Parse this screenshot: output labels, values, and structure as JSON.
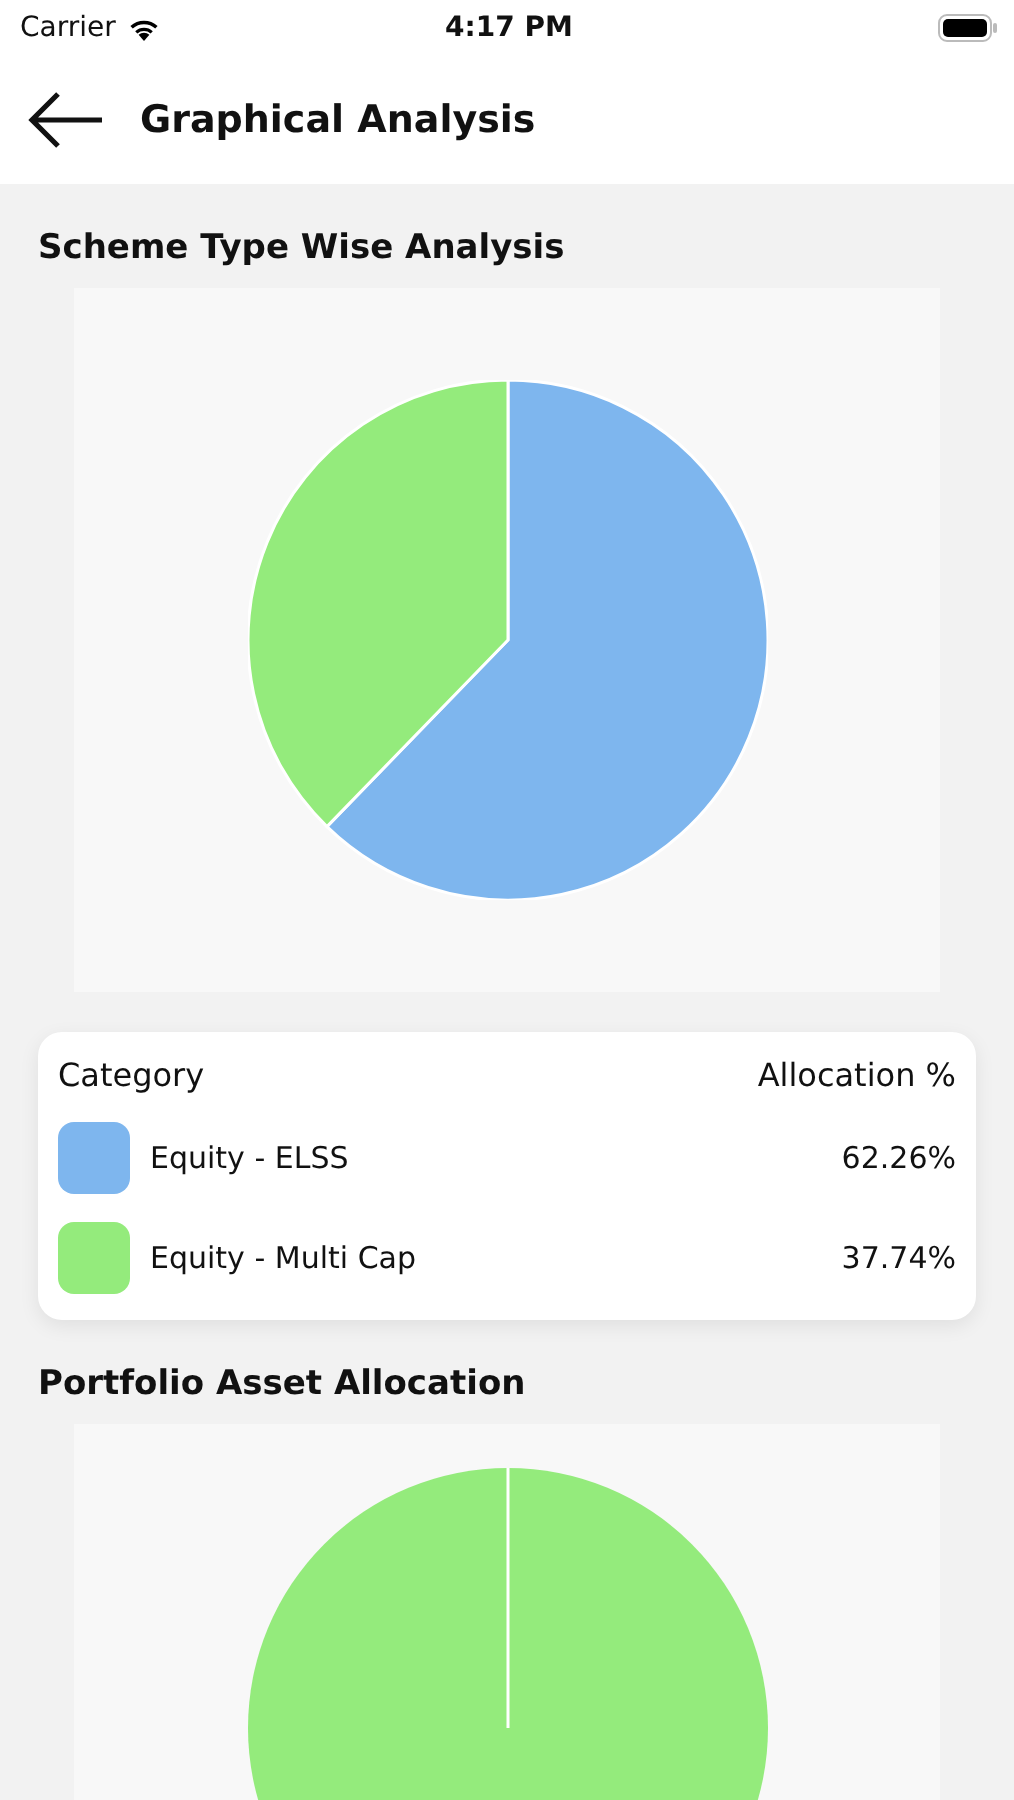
{
  "status_bar": {
    "carrier": "Carrier",
    "time": "4:17 PM"
  },
  "header": {
    "title": "Graphical Analysis"
  },
  "scheme_section": {
    "title": "Scheme Type Wise Analysis",
    "chart_data": {
      "type": "pie",
      "categories": [
        "Equity - ELSS",
        "Equity - Multi Cap"
      ],
      "series": [
        {
          "name": "Allocation %",
          "values": [
            62.26,
            37.74
          ]
        }
      ],
      "colors": [
        "#7eb6ee",
        "#94eb7c"
      ]
    },
    "legend": {
      "category_header": "Category",
      "rows": [
        {
          "allocation": "62.26%"
        },
        {
          "allocation": "37.74%"
        }
      ]
    }
  },
  "asset_section": {
    "title": "Portfolio Asset Allocation"
  }
}
